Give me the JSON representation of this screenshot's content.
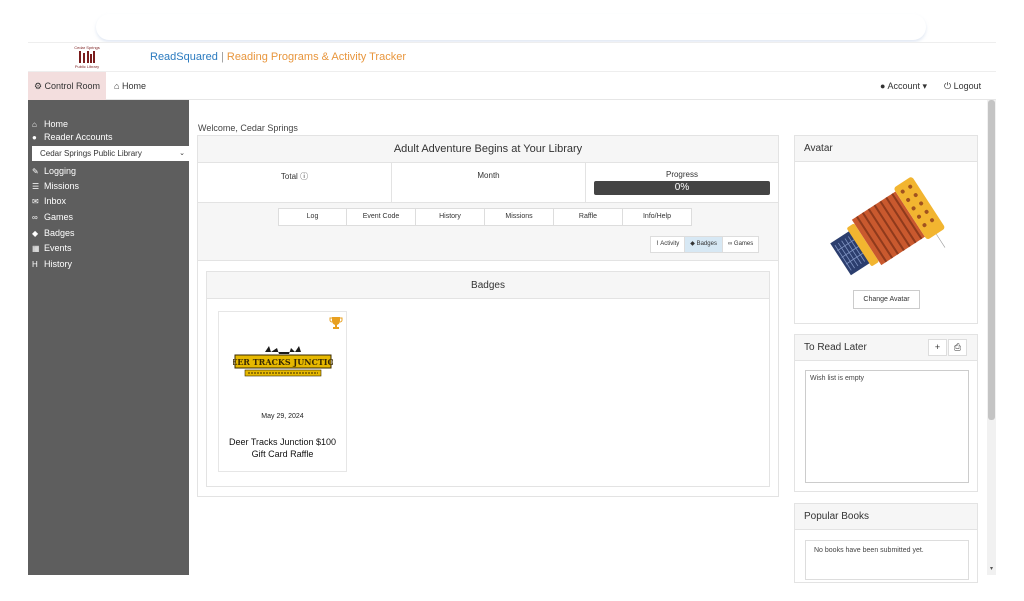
{
  "brand": {
    "library_top": "Cedar Springs",
    "library_bottom": "Public Library",
    "app_name": "ReadSquared",
    "separator": "|",
    "tagline": "Reading Programs & Activity Tracker"
  },
  "nav": {
    "control_room": "Control Room",
    "home": "Home",
    "account": "Account",
    "logout": "Logout"
  },
  "sidebar": {
    "home": "Home",
    "reader_accounts": "Reader Accounts",
    "library_select": "Cedar Springs Public Library",
    "items": [
      "Logging",
      "Missions",
      "Inbox",
      "Games",
      "Badges",
      "Events",
      "History"
    ]
  },
  "main": {
    "welcome": "Welcome,  Cedar Springs",
    "program_title": "Adult Adventure Begins at Your Library",
    "stats": {
      "total_label": "Total",
      "month_label": "Month",
      "progress_label": "Progress",
      "progress_value": "0%",
      "progress_fraction": 0
    },
    "tabs": [
      "Log",
      "Event Code",
      "History",
      "Missions",
      "Raffle",
      "Info/Help"
    ],
    "views": [
      {
        "label": "Activity",
        "active": false
      },
      {
        "label": "Badges",
        "active": true
      },
      {
        "label": "Games",
        "active": false
      }
    ],
    "badges": {
      "title": "Badges",
      "items": [
        {
          "logo_text": "DEER TRACKS JUNCTION",
          "date": "May 29, 2024",
          "name": "Deer Tracks Junction $100 Gift Card Raffle"
        }
      ]
    }
  },
  "right": {
    "avatar_title": "Avatar",
    "change_avatar": "Change Avatar",
    "to_read_title": "To Read Later",
    "add_symbol": "+",
    "wish_empty": "Wish list is empty",
    "popular_title": "Popular Books",
    "popular_empty": "No books have been submitted yet."
  },
  "colors": {
    "accent_blue": "#2a7abf",
    "accent_orange": "#e8963d",
    "sidebar_bg": "#5e5e5e",
    "control_room_bg": "#f3dede"
  }
}
